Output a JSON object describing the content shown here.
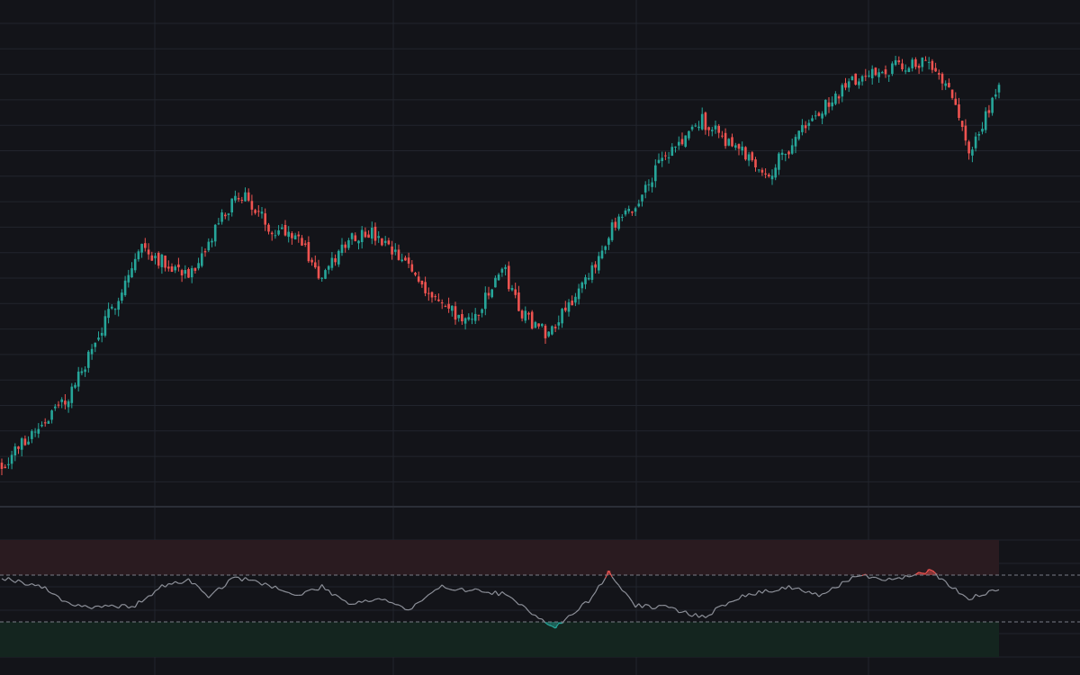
{
  "theme": {
    "background": "#131419",
    "grid": "#22252d",
    "separator": "#2b2e37",
    "up_color": "#26a69a",
    "down_color": "#ef5350",
    "overbought_zone": "#2a1b20",
    "oversold_zone": "#14251f",
    "reference_line": "#7a7d86"
  },
  "chart_data": [
    {
      "type": "candlestick",
      "panel": "price",
      "grid": true,
      "legend": "none",
      "x_count": 300,
      "ylim": [
        0,
        100
      ],
      "anchors": [
        [
          0,
          8
        ],
        [
          8,
          14
        ],
        [
          20,
          22
        ],
        [
          28,
          33
        ],
        [
          42,
          53
        ],
        [
          48,
          50
        ],
        [
          58,
          47
        ],
        [
          65,
          58
        ],
        [
          72,
          64
        ],
        [
          80,
          57
        ],
        [
          88,
          56
        ],
        [
          96,
          46
        ],
        [
          104,
          55
        ],
        [
          110,
          56
        ],
        [
          118,
          51
        ],
        [
          122,
          49
        ],
        [
          130,
          42
        ],
        [
          140,
          37
        ],
        [
          146,
          43
        ],
        [
          150,
          49
        ],
        [
          156,
          39
        ],
        [
          164,
          35
        ],
        [
          168,
          40
        ],
        [
          176,
          46
        ],
        [
          182,
          56
        ],
        [
          190,
          61
        ],
        [
          196,
          69
        ],
        [
          210,
          79
        ],
        [
          230,
          68
        ],
        [
          240,
          77
        ],
        [
          255,
          87
        ],
        [
          262,
          89
        ],
        [
          275,
          91
        ],
        [
          284,
          87
        ],
        [
          290,
          72
        ],
        [
          294,
          78
        ],
        [
          300,
          87
        ]
      ],
      "series": [
        {
          "name": "",
          "up_color": "#26a69a",
          "down_color": "#ef5350"
        }
      ]
    },
    {
      "type": "oscillator",
      "panel": "indicator",
      "grid": true,
      "legend": "none",
      "x_count": 300,
      "ylim": [
        0,
        100
      ],
      "upper_band": 70,
      "lower_band": 30,
      "zones": {
        "overbought": [
          70,
          100
        ],
        "oversold": [
          0,
          30
        ]
      },
      "anchors": [
        [
          0,
          68
        ],
        [
          12,
          60
        ],
        [
          20,
          46
        ],
        [
          28,
          42
        ],
        [
          40,
          44
        ],
        [
          48,
          60
        ],
        [
          56,
          66
        ],
        [
          62,
          52
        ],
        [
          70,
          68
        ],
        [
          80,
          62
        ],
        [
          88,
          52
        ],
        [
          96,
          60
        ],
        [
          104,
          46
        ],
        [
          114,
          50
        ],
        [
          122,
          40
        ],
        [
          132,
          60
        ],
        [
          150,
          54
        ],
        [
          158,
          40
        ],
        [
          166,
          25
        ],
        [
          176,
          48
        ],
        [
          182,
          72
        ],
        [
          190,
          44
        ],
        [
          200,
          42
        ],
        [
          210,
          34
        ],
        [
          222,
          52
        ],
        [
          236,
          60
        ],
        [
          246,
          52
        ],
        [
          256,
          70
        ],
        [
          268,
          66
        ],
        [
          278,
          74
        ],
        [
          290,
          50
        ],
        [
          300,
          58
        ]
      ]
    }
  ]
}
